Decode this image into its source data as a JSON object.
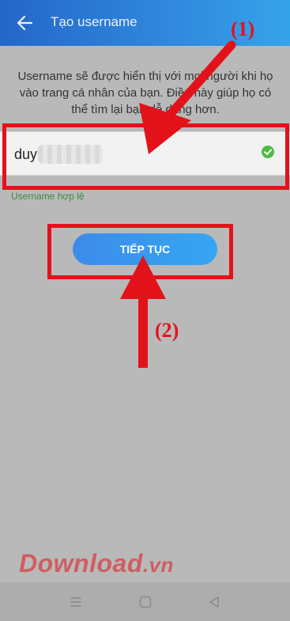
{
  "header": {
    "title": "Tạo username",
    "back_icon": "arrow-left-icon"
  },
  "description": "Username sẽ được hiển thị với mọi người khi họ vào trang cá nhân của bạn. Điều này giúp họ có thể tìm lại bạn dễ dàng hơn.",
  "username_field": {
    "value": "duy",
    "status_icon": "check-circle-icon",
    "status_color": "#4cbb47"
  },
  "validation_message": "Username hợp lệ",
  "continue_button": {
    "label": "TIẾP TỤC"
  },
  "annotations": {
    "label_1": "(1)",
    "label_2": "(2)",
    "color": "#e3121a"
  },
  "watermark": {
    "text": "Download",
    "suffix": ".vn"
  },
  "navbar": {
    "icons": [
      "menu-icon",
      "home-square-icon",
      "back-triangle-icon"
    ]
  }
}
